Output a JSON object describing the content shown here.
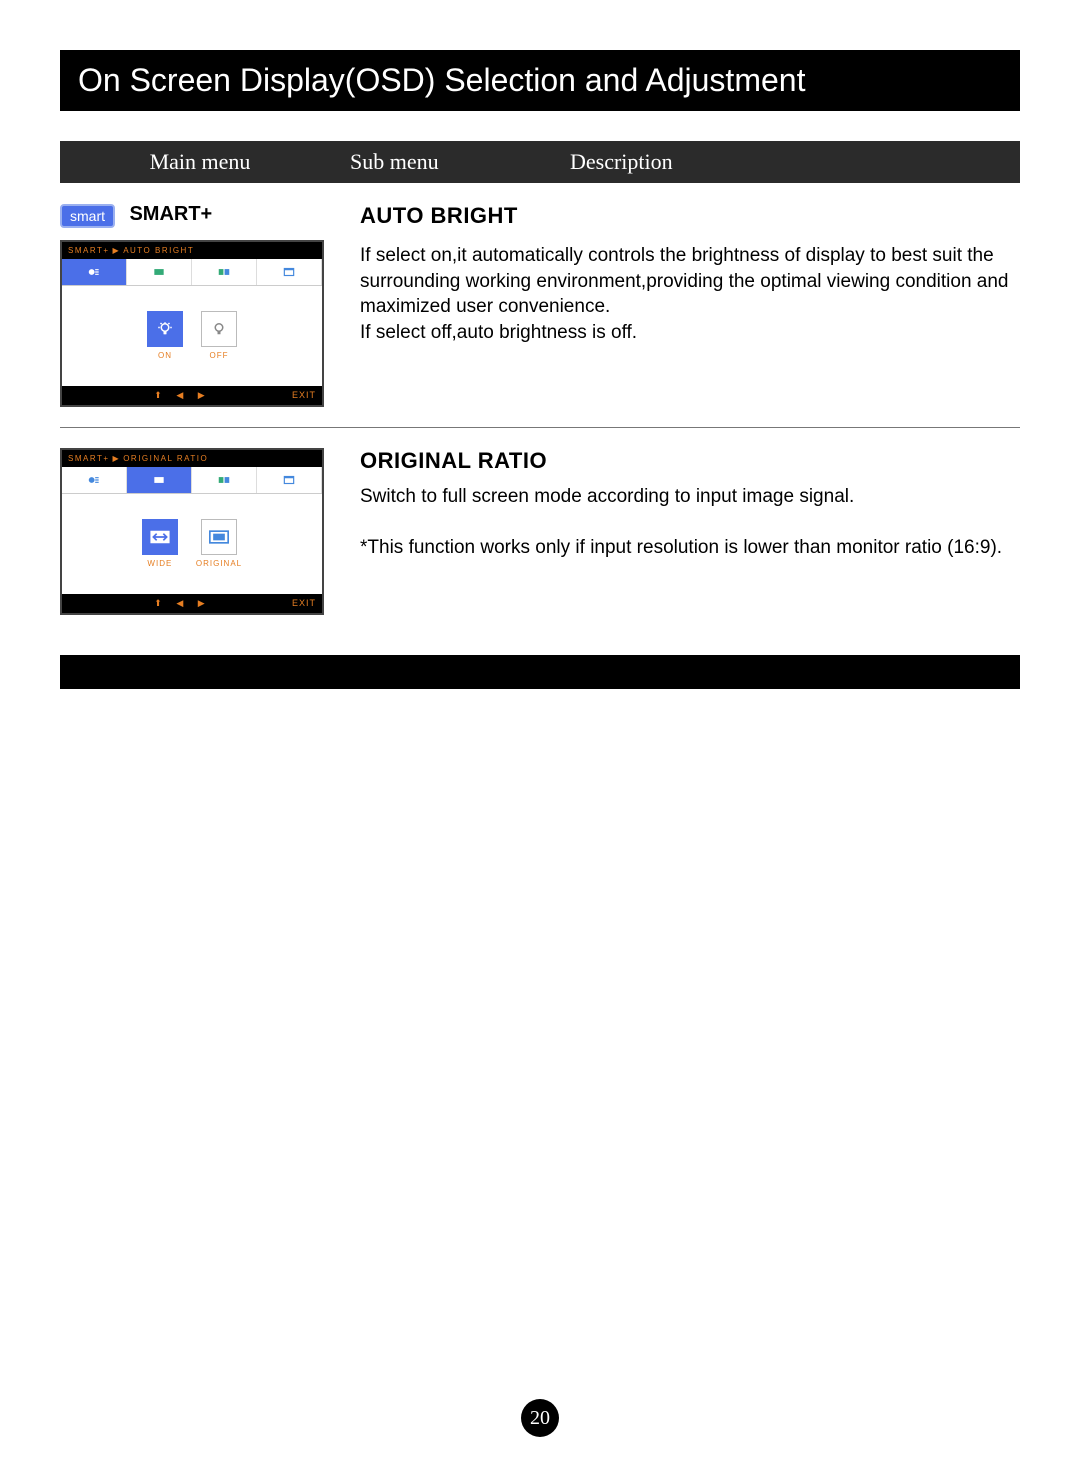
{
  "title": "On Screen Display(OSD) Selection and Adjustment",
  "headers": {
    "main": "Main menu",
    "sub": "Sub menu",
    "desc": "Description"
  },
  "main_menu": {
    "badge": "smart",
    "label": "SMART+"
  },
  "sections": [
    {
      "osd": {
        "crumb1": "SMART+",
        "crumb2": "AUTO BRIGHT",
        "opt1": "ON",
        "opt2": "OFF",
        "exit": "EXIT"
      },
      "title": "AUTO BRIGHT",
      "desc1": "If select on,it automatically controls the brightness of display to best suit the surrounding working environment,providing the optimal viewing condition and maximized user convenience.",
      "desc2": "If select off,auto brightness is off."
    },
    {
      "osd": {
        "crumb1": "SMART+",
        "crumb2": "ORIGINAL RATIO",
        "opt1": "WIDE",
        "opt2": "ORIGINAL",
        "exit": "EXIT"
      },
      "title": "ORIGINAL RATIO",
      "desc1": "Switch to full screen mode according to input image signal.",
      "desc2": "*This function works only if input resolution is lower than monitor ratio (16:9)."
    }
  ],
  "page_number": "20"
}
